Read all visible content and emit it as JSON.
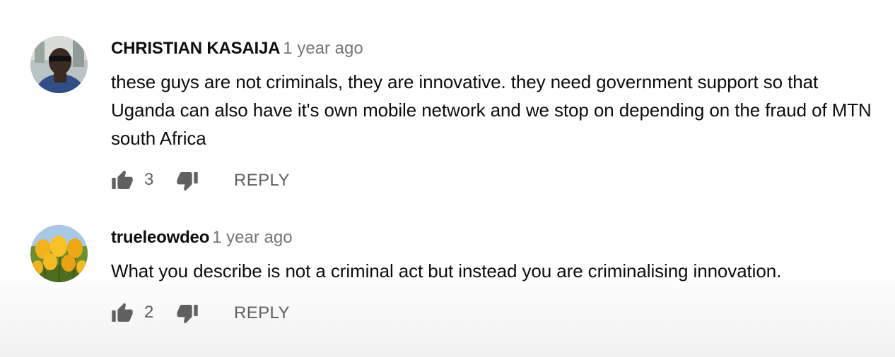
{
  "comments": [
    {
      "author": "CHRISTIAN KASAIJA",
      "time": "1 year ago",
      "text": "these guys are not criminals, they are innovative. they need government support so that Uganda can also have it's own mobile network and we stop on depending on the fraud of MTN south Africa",
      "likes": "3",
      "reply_label": "REPLY",
      "avatar": "person-photo"
    },
    {
      "author": "trueleowdeo",
      "time": "1 year ago",
      "text": "What you describe is not a criminal act but instead you are criminalising innovation.",
      "likes": "2",
      "reply_label": "REPLY",
      "avatar": "tulips-photo"
    }
  ],
  "icons": {
    "like": "thumbs-up-icon",
    "dislike": "thumbs-down-icon"
  },
  "colors": {
    "text": "#0d0d0d",
    "secondary": "#767676",
    "icon": "#606060"
  }
}
